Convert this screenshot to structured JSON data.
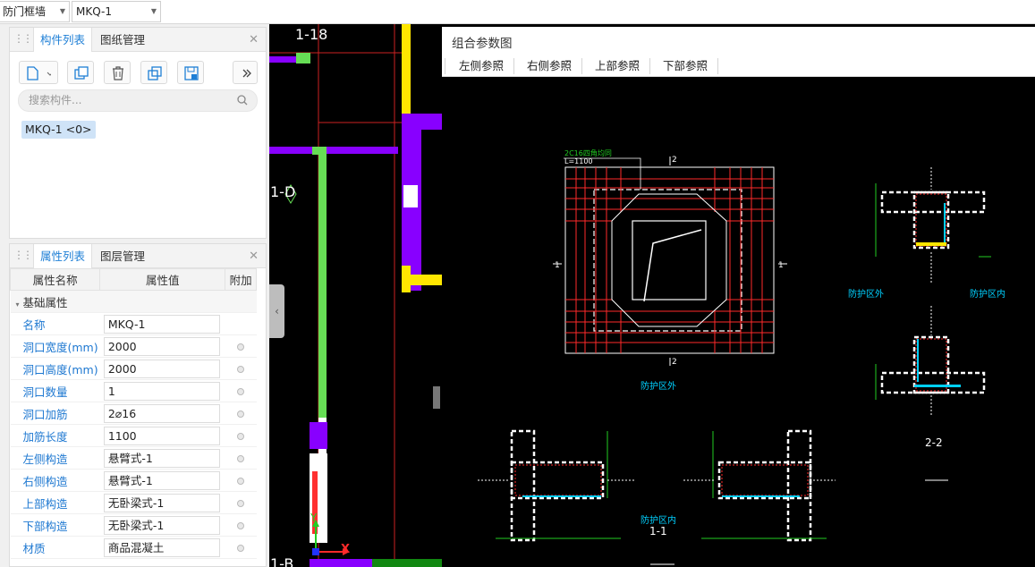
{
  "toolbar": {
    "category_value": "防门框墙",
    "component_value": "MKQ-1"
  },
  "component_panel": {
    "tabs": [
      "构件列表",
      "图纸管理"
    ],
    "search_placeholder": "搜索构件...",
    "items": [
      "MKQ-1 <0>"
    ]
  },
  "property_panel": {
    "tabs": [
      "属性列表",
      "图层管理"
    ],
    "columns": [
      "属性名称",
      "属性值",
      "附加"
    ],
    "section": "基础属性",
    "rows": [
      {
        "name": "名称",
        "value": "MKQ-1",
        "has_add": false
      },
      {
        "name": "洞口宽度(mm)",
        "value": "2000",
        "has_add": true
      },
      {
        "name": "洞口高度(mm)",
        "value": "2000",
        "has_add": true
      },
      {
        "name": "洞口数量",
        "value": "1",
        "has_add": true
      },
      {
        "name": "洞口加筋",
        "value": "2⌀16",
        "has_add": true
      },
      {
        "name": "加筋长度",
        "value": "1100",
        "has_add": true
      },
      {
        "name": "左侧构造",
        "value": "悬臂式-1",
        "has_add": true
      },
      {
        "name": "右侧构造",
        "value": "悬臂式-1",
        "has_add": true
      },
      {
        "name": "上部构造",
        "value": "无卧梁式-1",
        "has_add": true
      },
      {
        "name": "下部构造",
        "value": "无卧梁式-1",
        "has_add": true
      },
      {
        "name": "材质",
        "value": "商品混凝土",
        "has_add": true
      }
    ]
  },
  "canvas": {
    "axis_labels": [
      "1-18",
      "1-D",
      "1-B"
    ],
    "axis_x": "X",
    "axis_y": "Y"
  },
  "dialog": {
    "title": "组合参数图",
    "tabs": [
      "左侧参照",
      "右侧参照",
      "上部参照",
      "下部参照"
    ],
    "drawing": {
      "rebar_note_1": "2C16四角均同",
      "rebar_note_2": "L=1100",
      "section_mark_top": "2",
      "section_mark_bottom": "2",
      "section_mark_left": "1",
      "section_mark_right": "1",
      "main_caption": "防护区外",
      "caption_outside": "防护区外",
      "caption_inside": "防护区内",
      "caption_bottom": "防护区内",
      "section_11": "1-1",
      "section_22": "2-2"
    }
  },
  "colors": {
    "accent_blue": "#1e7fd6",
    "cad_background": "#000000",
    "wall_purple": "#8800ff",
    "wall_green": "#66dd55",
    "cad_red": "#ff2a2a",
    "cad_cyan": "#00d0ff",
    "cad_yellow": "#ffe600"
  }
}
